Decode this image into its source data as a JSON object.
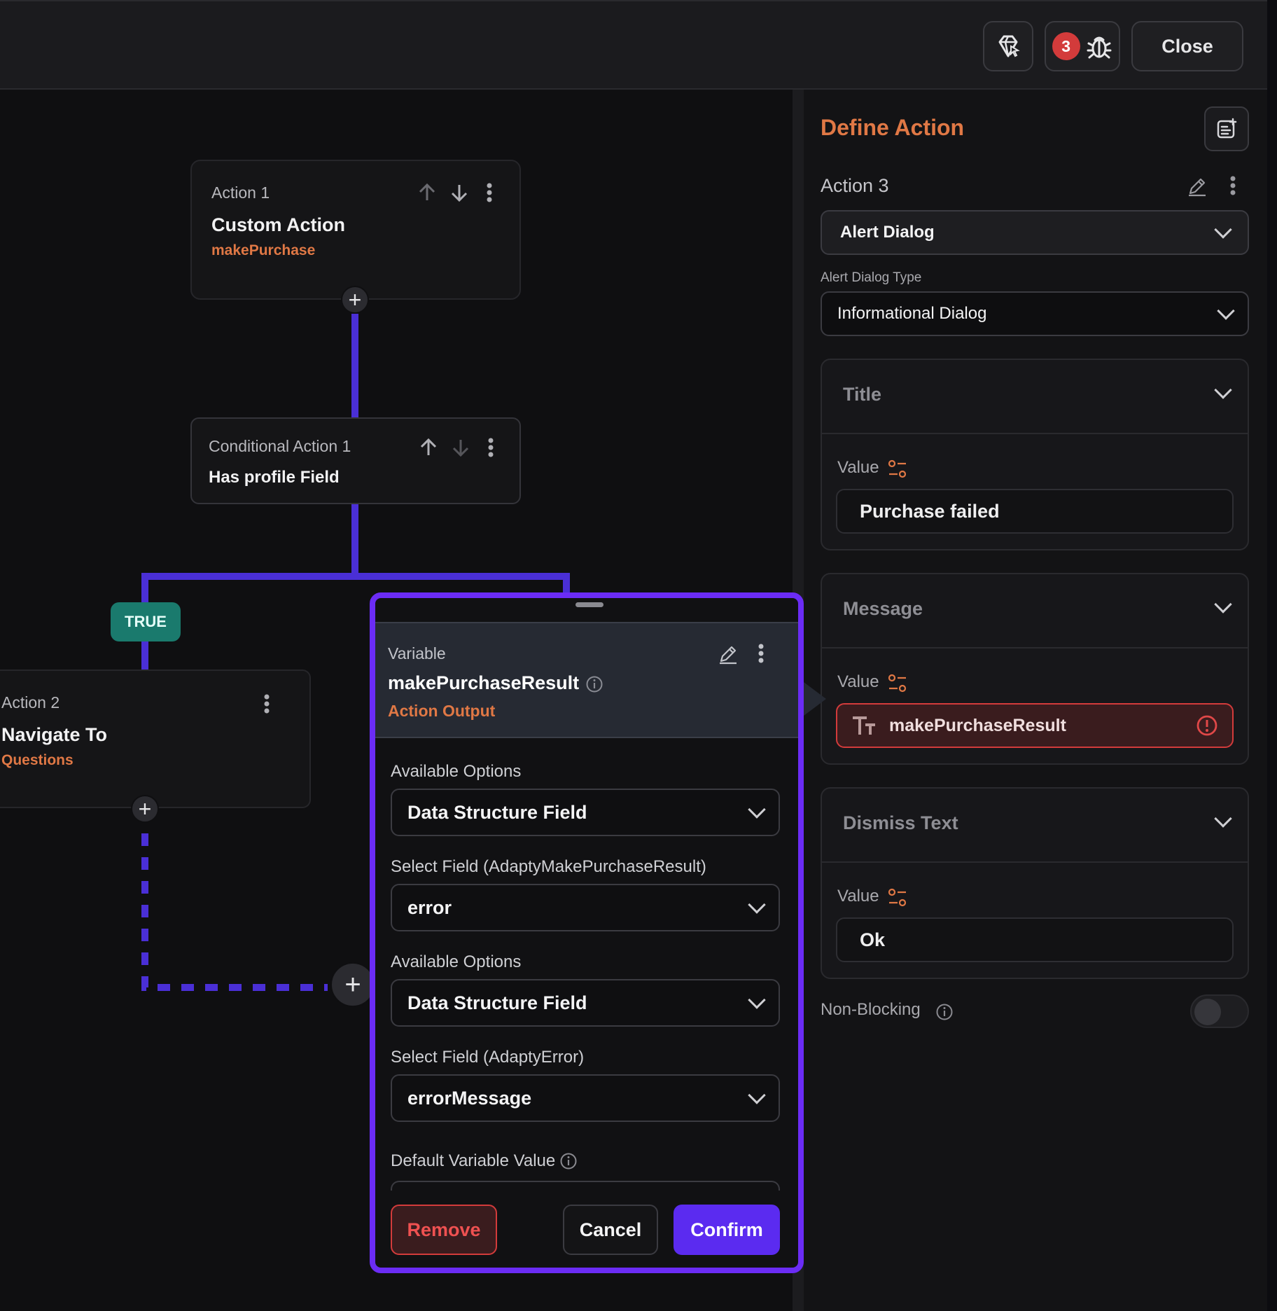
{
  "topbar": {
    "bug_count": "3",
    "close_label": "Close",
    "icons": [
      "diamond-cursor-icon",
      "bug-icon"
    ]
  },
  "canvas": {
    "action1": {
      "label": "Action 1",
      "title": "Custom Action",
      "subtitle": "makePurchase"
    },
    "conditional": {
      "label": "Conditional Action 1",
      "title": "Has profile Field"
    },
    "true_label": "TRUE",
    "action2": {
      "label": "Action 2",
      "title": "Navigate To",
      "subtitle": "Questions"
    }
  },
  "modal": {
    "header_label": "Variable",
    "variable_name": "makePurchaseResult",
    "source": "Action Output",
    "options1_label": "Available Options",
    "options1_value": "Data Structure Field",
    "field1_label": "Select Field (AdaptyMakePurchaseResult)",
    "field1_value": "error",
    "options2_label": "Available Options",
    "options2_value": "Data Structure Field",
    "field2_label": "Select Field (AdaptyError)",
    "field2_value": "errorMessage",
    "default_label": "Default Variable Value",
    "remove_label": "Remove",
    "cancel_label": "Cancel",
    "confirm_label": "Confirm"
  },
  "panel": {
    "heading": "Define Action",
    "action_name": "Action 3",
    "action_type": "Alert Dialog",
    "dialog_type_label": "Alert Dialog Type",
    "dialog_type_value": "Informational Dialog",
    "title_section": {
      "title": "Title",
      "value_label": "Value",
      "value": "Purchase failed"
    },
    "message_section": {
      "title": "Message",
      "value_label": "Value",
      "value": "makePurchaseResult"
    },
    "dismiss_section": {
      "title": "Dismiss Text",
      "value_label": "Value",
      "value": "Ok"
    },
    "non_blocking_label": "Non-Blocking"
  },
  "colors": {
    "accent": "#6b2cf5",
    "connector": "#4a2fd6",
    "orange": "#e07845",
    "error": "#d33b3b",
    "confirm": "#5b2bf0",
    "true_badge": "#1a7a6d"
  }
}
